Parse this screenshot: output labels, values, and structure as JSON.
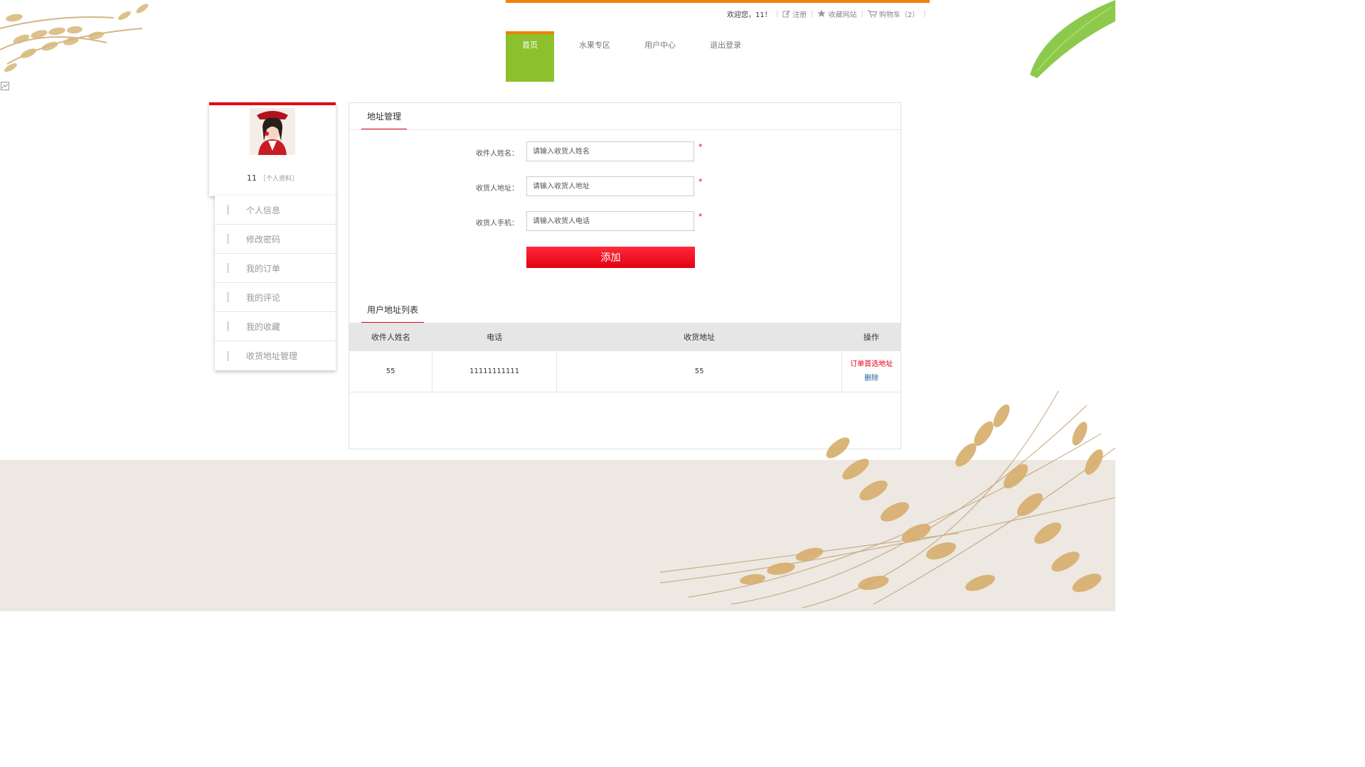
{
  "header": {
    "welcome": "欢迎您，11！",
    "register": "注册",
    "favorite_site": "收藏网站",
    "cart_label": "购物车",
    "cart_count": "（2）",
    "accent_color": "#f08200"
  },
  "nav": {
    "items": [
      {
        "label": "首页",
        "active": true
      },
      {
        "label": "水果专区",
        "active": false
      },
      {
        "label": "用户中心",
        "active": false
      },
      {
        "label": "退出登录",
        "active": false
      }
    ],
    "active_color": "#8cc12d"
  },
  "profile": {
    "username": "11",
    "profile_link": "［个人资料］"
  },
  "sidebar": {
    "items": [
      {
        "label": "个人信息"
      },
      {
        "label": "修改密码"
      },
      {
        "label": "我的订单"
      },
      {
        "label": "我的评论"
      },
      {
        "label": "我的收藏"
      },
      {
        "label": "收货地址管理"
      }
    ]
  },
  "address_form": {
    "title": "地址管理",
    "name_label": "收件人姓名：",
    "name_placeholder": "请输入收货人姓名",
    "address_label": "收货人地址：",
    "address_placeholder": "请输入收货人地址",
    "phone_label": "收货人手机：",
    "phone_placeholder": "请输入收货人电话",
    "required_mark": "*",
    "submit_label": "添加"
  },
  "address_list": {
    "title": "用户地址列表",
    "columns": [
      "收件人姓名",
      "电话",
      "收货地址",
      "操作"
    ],
    "rows": [
      {
        "name": "55",
        "phone": "11111111111",
        "address": "55",
        "action_primary": "订单首选地址",
        "action_delete": "删除"
      }
    ]
  }
}
